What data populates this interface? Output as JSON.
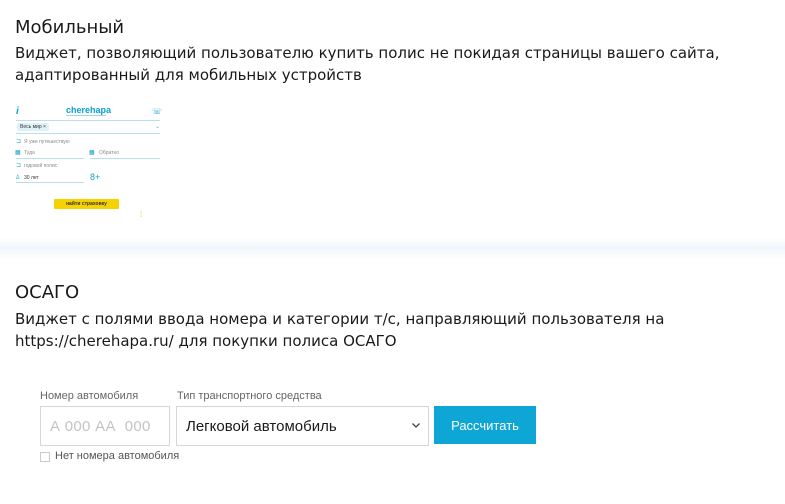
{
  "mobile": {
    "title": "Мобильный",
    "description": "Виджет, позволяющий пользователю купить полис не покидая страницы вашего сайта, адаптированный для мобильных устройств",
    "preview": {
      "logo": "cherehapa",
      "destination_chip": "Весь мир ×",
      "travellers": "Я уже путешествую",
      "from_placeholder": "Туда",
      "back_placeholder": "Обратно",
      "annual": "годовой полис",
      "age": "30 лет",
      "button": "найти страховку"
    }
  },
  "osago": {
    "title": "ОСАГО",
    "description": "Виджет с полями ввода номера и категории т/с, направляющий пользователя на https://cherehapa.ru/ для покупки полиса ОСАГО",
    "plate_label": "Номер автомобиля",
    "plate_placeholder": "А 000 АА  000",
    "vehicle_label": "Тип транспортного средства",
    "vehicle_value": "Легковой автомобиль",
    "calc_button": "Рассчитать",
    "no_plate_label": "Нет номера автомобиля"
  }
}
